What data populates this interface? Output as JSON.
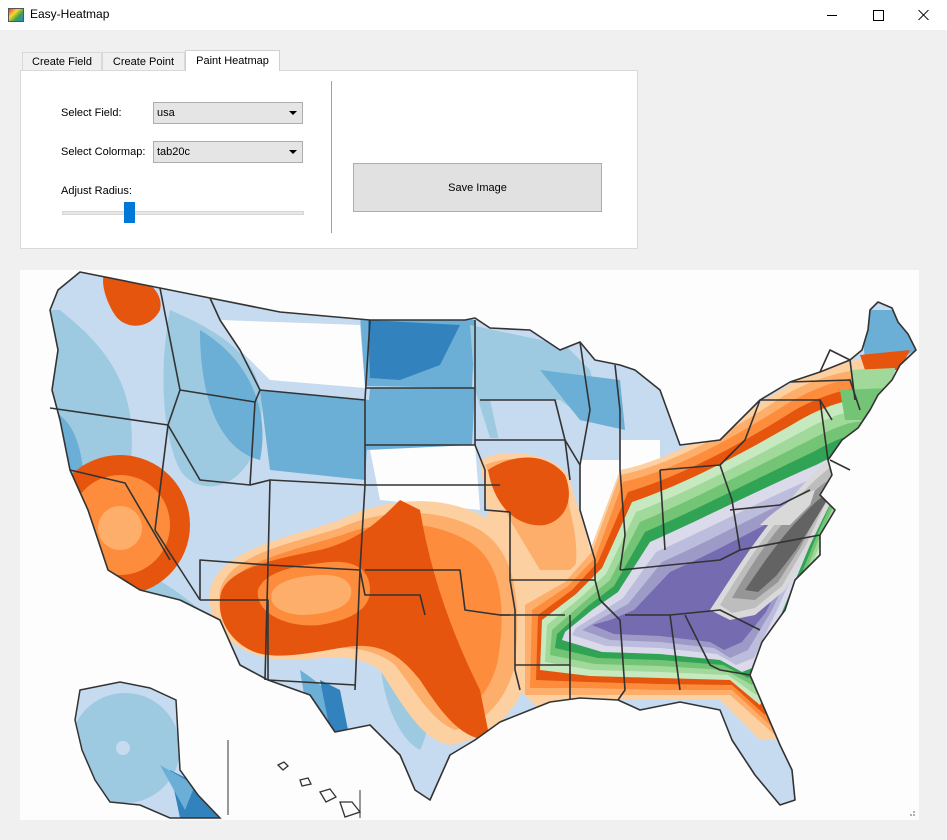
{
  "window": {
    "title": "Easy-Heatmap",
    "controls": [
      "minimize",
      "maximize",
      "close"
    ]
  },
  "tabs": [
    {
      "label": "Create Field",
      "active": false
    },
    {
      "label": "Create Point",
      "active": false
    },
    {
      "label": "Paint Heatmap",
      "active": true
    }
  ],
  "form": {
    "field_label": "Select Field:",
    "field_value": "usa",
    "colormap_label": "Select Colormap:",
    "colormap_value": "tab20c",
    "radius_label": "Adjust Radius:",
    "radius_level": 0.27,
    "save_label": "Save Image"
  },
  "heatmap": {
    "colormap_colors": {
      "blue": [
        "#3182bd",
        "#6baed6",
        "#9ecae1",
        "#c6dbef"
      ],
      "orange": [
        "#e6550d",
        "#fd8d3c",
        "#fdae6b",
        "#fdd0a2"
      ],
      "green": [
        "#31a354",
        "#74c476",
        "#a1d99b",
        "#c7e9c0"
      ],
      "purple": [
        "#756bb1",
        "#9e9ac8",
        "#bcbddc",
        "#dadaeb"
      ],
      "gray": [
        "#636363",
        "#969696",
        "#bdbdbd",
        "#d9d9d9"
      ]
    },
    "background": "#fdfdfd",
    "outline_color": "#333333"
  }
}
